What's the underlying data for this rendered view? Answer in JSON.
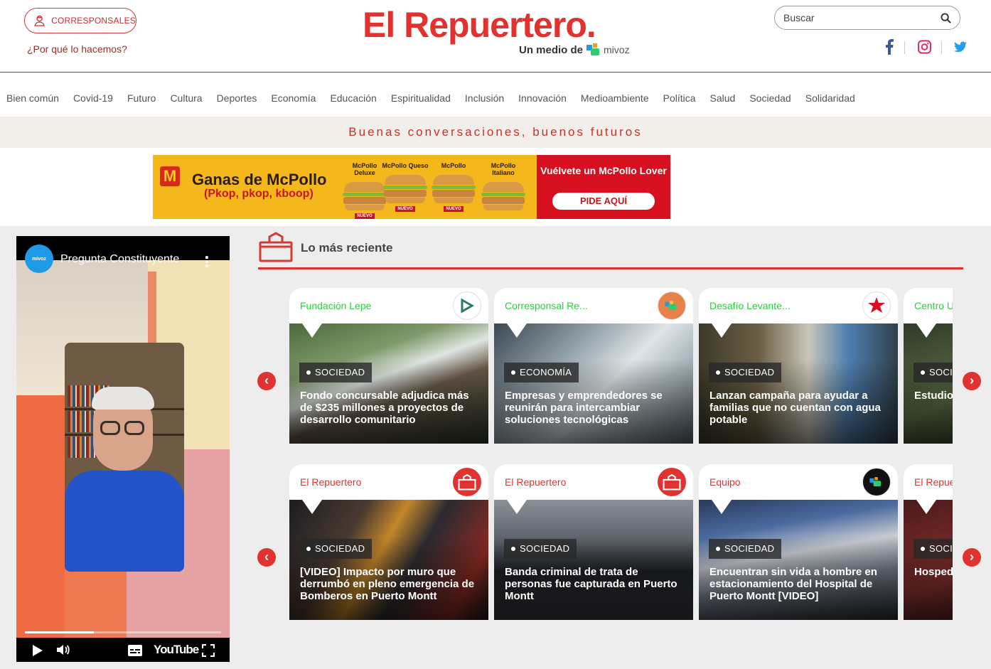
{
  "header": {
    "corresponsales_label": "CORRESPONSALES",
    "why_link": "¿Por qué lo hacemos?",
    "logo_text": "El Repuertero.",
    "tagline_prefix": "Un medio de",
    "tagline_brand": "mivoz",
    "search_placeholder": "Buscar"
  },
  "nav": {
    "items": [
      "Bien común",
      "Covid-19",
      "Futuro",
      "Cultura",
      "Deportes",
      "Economía",
      "Educación",
      "Espiritualidad",
      "Inclusión",
      "Innovación",
      "Medioambiente",
      "Política",
      "Salud",
      "Sociedad",
      "Solidaridad"
    ]
  },
  "slogan": "Buenas conversaciones, buenos futuros",
  "ad": {
    "title": "Ganas de McPollo",
    "subtitle": "(Pkop, pkop, kboop)",
    "products": [
      "McPollo Deluxe",
      "McPollo Queso",
      "McPollo",
      "McPollo Italiano"
    ],
    "new_tag": "NUEVO",
    "cta_text": "Vuélvete un McPollo Lover",
    "cta_button": "PIDE AQUÍ",
    "brand_color": "#da291c"
  },
  "video": {
    "title": "Pregunta Constituyente",
    "channel": "mivoz",
    "player_brand": "YouTube",
    "progress": 0.35
  },
  "recent": {
    "title": "Lo más reciente",
    "row1": [
      {
        "source": "Fundación Lepe",
        "source_color": "#2ecc40",
        "category": "SOCIEDAD",
        "headline": "Fondo concursable adjudica más de $235 millones a proyectos de desarrollo comunitario"
      },
      {
        "source": "Corresponsal Re...",
        "source_color": "#2ecc40",
        "category": "ECONOMÍA",
        "headline": "Empresas y emprendedores se reunirán para intercambiar soluciones tecnológicas"
      },
      {
        "source": "Desafío Levante...",
        "source_color": "#2ecc40",
        "category": "SOCIEDAD",
        "headline": "Lanzan campaña para ayudar a familias que no cuentan con agua potable"
      },
      {
        "source": "Centro U",
        "source_color": "#2ecc40",
        "category": "SOCIE",
        "headline": "Estudio la prote"
      }
    ],
    "row2": [
      {
        "source": "El Repuertero",
        "source_color": "#d13a36",
        "category": "SOCIEDAD",
        "headline": "[VIDEO] Impacto por muro que derrumbó en pleno emergencia de Bomberos en Puerto Montt"
      },
      {
        "source": "El Repuertero",
        "source_color": "#d13a36",
        "category": "SOCIEDAD",
        "headline": "Banda criminal de trata de personas fue capturada en Puerto Montt"
      },
      {
        "source": "Equipo",
        "source_color": "#d13a36",
        "category": "SOCIEDAD",
        "headline": "Encuentran sin vida a hombre en estacionamiento del Hospital de Puerto Montt [VIDEO]"
      },
      {
        "source": "El Repue",
        "source_color": "#d13a36",
        "category": "SOCIE",
        "headline": "Hosped destruid lesiona"
      }
    ]
  },
  "colors": {
    "accent": "#e0322e",
    "green": "#2ecc40"
  }
}
